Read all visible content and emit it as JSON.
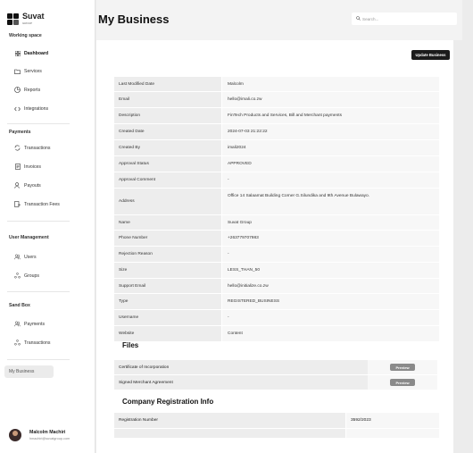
{
  "app": {
    "logo_text": "Suvat",
    "logo_sub": "GROUP",
    "page_title": "My Business"
  },
  "search": {
    "placeholder": "Search..."
  },
  "sidebar": {
    "working_space_title": "Working space",
    "working_space": [
      {
        "label": "Dashboard",
        "icon": "grid-icon"
      },
      {
        "label": "Services",
        "icon": "folder-icon"
      },
      {
        "label": "Reports",
        "icon": "pie-chart-icon"
      },
      {
        "label": "Integrations",
        "icon": "code-icon"
      }
    ],
    "payments_title": "Payments",
    "payments": [
      {
        "label": "Transactions",
        "icon": "refresh-icon"
      },
      {
        "label": "Invoices",
        "icon": "document-icon"
      },
      {
        "label": "Payouts",
        "icon": "person-icon"
      },
      {
        "label": "Transaction Fees",
        "icon": "file-export-icon"
      }
    ],
    "user_management_title": "User Management",
    "user_management": [
      {
        "label": "Users",
        "icon": "users-icon"
      },
      {
        "label": "Groups",
        "icon": "groups-icon"
      }
    ],
    "sandbox_title": "Sand Box",
    "sandbox": [
      {
        "label": "Payments",
        "icon": "users-icon"
      },
      {
        "label": "Transactions",
        "icon": "groups-icon"
      }
    ],
    "my_business_label": "My Business"
  },
  "user": {
    "name": "Malcolm Machiri",
    "email": "hmachiri@suvatgroup.com"
  },
  "actions": {
    "update_business": "Update Business"
  },
  "details": [
    {
      "key": "Last Modified Date",
      "value": "Malcolm"
    },
    {
      "key": "Email",
      "value": "hello@imali.co.zw"
    },
    {
      "key": "Description",
      "value": "FinTech Products and Services, Bill and Merchant payments"
    },
    {
      "key": "Created Date",
      "value": "2024-07-03 21:22:22"
    },
    {
      "key": "Created By",
      "value": "imali2024"
    },
    {
      "key": "Approval Status",
      "value": "APPROVED"
    },
    {
      "key": "Approval Comment",
      "value": "-"
    },
    {
      "key": "Address",
      "value": "Office 14 Salaamat Building Corner G.Silundika and 9th Avenue Bulawayo."
    },
    {
      "key": "Name",
      "value": "Suvat Group"
    },
    {
      "key": "Phone Number",
      "value": "+263779707983"
    },
    {
      "key": "Rejection Reason",
      "value": "-"
    },
    {
      "key": "Size",
      "value": "LESS_THAN_50"
    },
    {
      "key": "Support Email",
      "value": "hello@initialize.co.zw"
    },
    {
      "key": "Type",
      "value": "REGISTERED_BUSINESS"
    },
    {
      "key": "Username",
      "value": "-"
    },
    {
      "key": "Website",
      "value": "Content"
    }
  ],
  "files_title": "Files",
  "files": [
    {
      "name": "Certificate of Incorporation",
      "action": "Preview"
    },
    {
      "name": "Signed Merchant Agreement",
      "action": "Preview"
    }
  ],
  "registration_title": "Company Registration Info",
  "registration": [
    {
      "key": "Registration Number",
      "value": "3592/2023"
    }
  ]
}
